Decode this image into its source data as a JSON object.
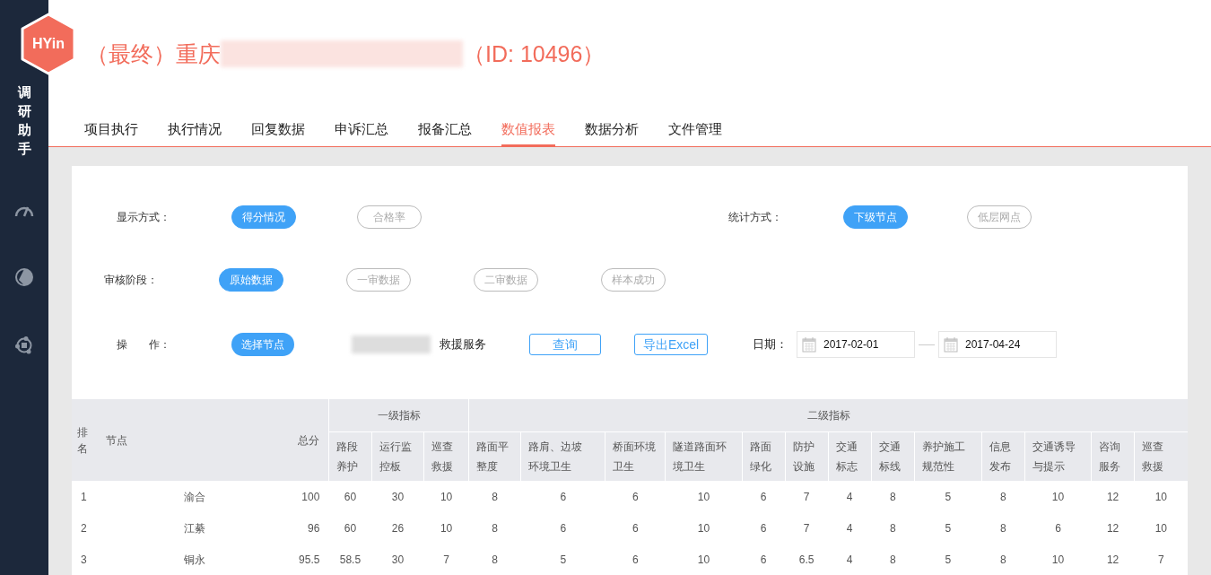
{
  "sidebar": {
    "logo_text": "HYin",
    "brand": "调研助手"
  },
  "title": {
    "prefix": "（最终）重庆",
    "suffix": "（ID: 10496）"
  },
  "tabs": [
    {
      "label": "项目执行",
      "selected": false
    },
    {
      "label": "执行情况",
      "selected": false
    },
    {
      "label": "回复数据",
      "selected": false
    },
    {
      "label": "申诉汇总",
      "selected": false
    },
    {
      "label": "报备汇总",
      "selected": false
    },
    {
      "label": "数值报表",
      "selected": true
    },
    {
      "label": "数据分析",
      "selected": false
    },
    {
      "label": "文件管理",
      "selected": false
    }
  ],
  "filters": {
    "display": {
      "label": "显示方式：",
      "options": [
        {
          "label": "得分情况",
          "selected": true
        },
        {
          "label": "合格率",
          "selected": false
        }
      ]
    },
    "statistic": {
      "label": "统计方式：",
      "options": [
        {
          "label": "下级节点",
          "selected": true
        },
        {
          "label": "低层网点",
          "selected": false
        }
      ]
    },
    "review": {
      "label": "审核阶段：",
      "options": [
        {
          "label": "原始数据",
          "selected": true
        },
        {
          "label": "一审数据",
          "selected": false
        },
        {
          "label": "二审数据",
          "selected": false
        },
        {
          "label": "样本成功",
          "selected": false
        }
      ]
    },
    "operation": {
      "label": "操　　作：",
      "select_button": "选择节点",
      "node_text": "救援服务",
      "query_button": "查询",
      "export_button": "导出Excel",
      "date_label": "日期：",
      "date_from": "2017-02-01",
      "date_to": "2017-04-24"
    }
  },
  "table": {
    "fixed_columns": [
      "排名",
      "节点",
      "总分"
    ],
    "groups": [
      {
        "label": "一级指标",
        "columns": [
          "路段养护",
          "运行监控板",
          "巡查救援"
        ]
      },
      {
        "label": "二级指标",
        "columns": [
          "路面平整度",
          "路肩、边坡环境卫生",
          "桥面环境卫生",
          "隧道路面环境卫生",
          "路面绿化",
          "防护设施",
          "交通标志",
          "交通标线",
          "养护施工规范性",
          "信息发布",
          "交通诱导与提示",
          "咨询服务",
          "巡查救援"
        ]
      }
    ],
    "rows": [
      {
        "rank": "1",
        "node": "渝合",
        "total": "100",
        "scores": [
          "60",
          "30",
          "10",
          "8",
          "6",
          "6",
          "10",
          "6",
          "7",
          "4",
          "8",
          "5",
          "8",
          "10",
          "12",
          "10"
        ]
      },
      {
        "rank": "2",
        "node": "江綦",
        "total": "96",
        "scores": [
          "60",
          "26",
          "10",
          "8",
          "6",
          "6",
          "10",
          "6",
          "7",
          "4",
          "8",
          "5",
          "8",
          "6",
          "12",
          "10"
        ]
      },
      {
        "rank": "3",
        "node": "铜永",
        "total": "95.5",
        "scores": [
          "58.5",
          "30",
          "7",
          "8",
          "5",
          "6",
          "10",
          "6",
          "6.5",
          "4",
          "8",
          "5",
          "8",
          "10",
          "12",
          "7"
        ]
      }
    ]
  }
}
